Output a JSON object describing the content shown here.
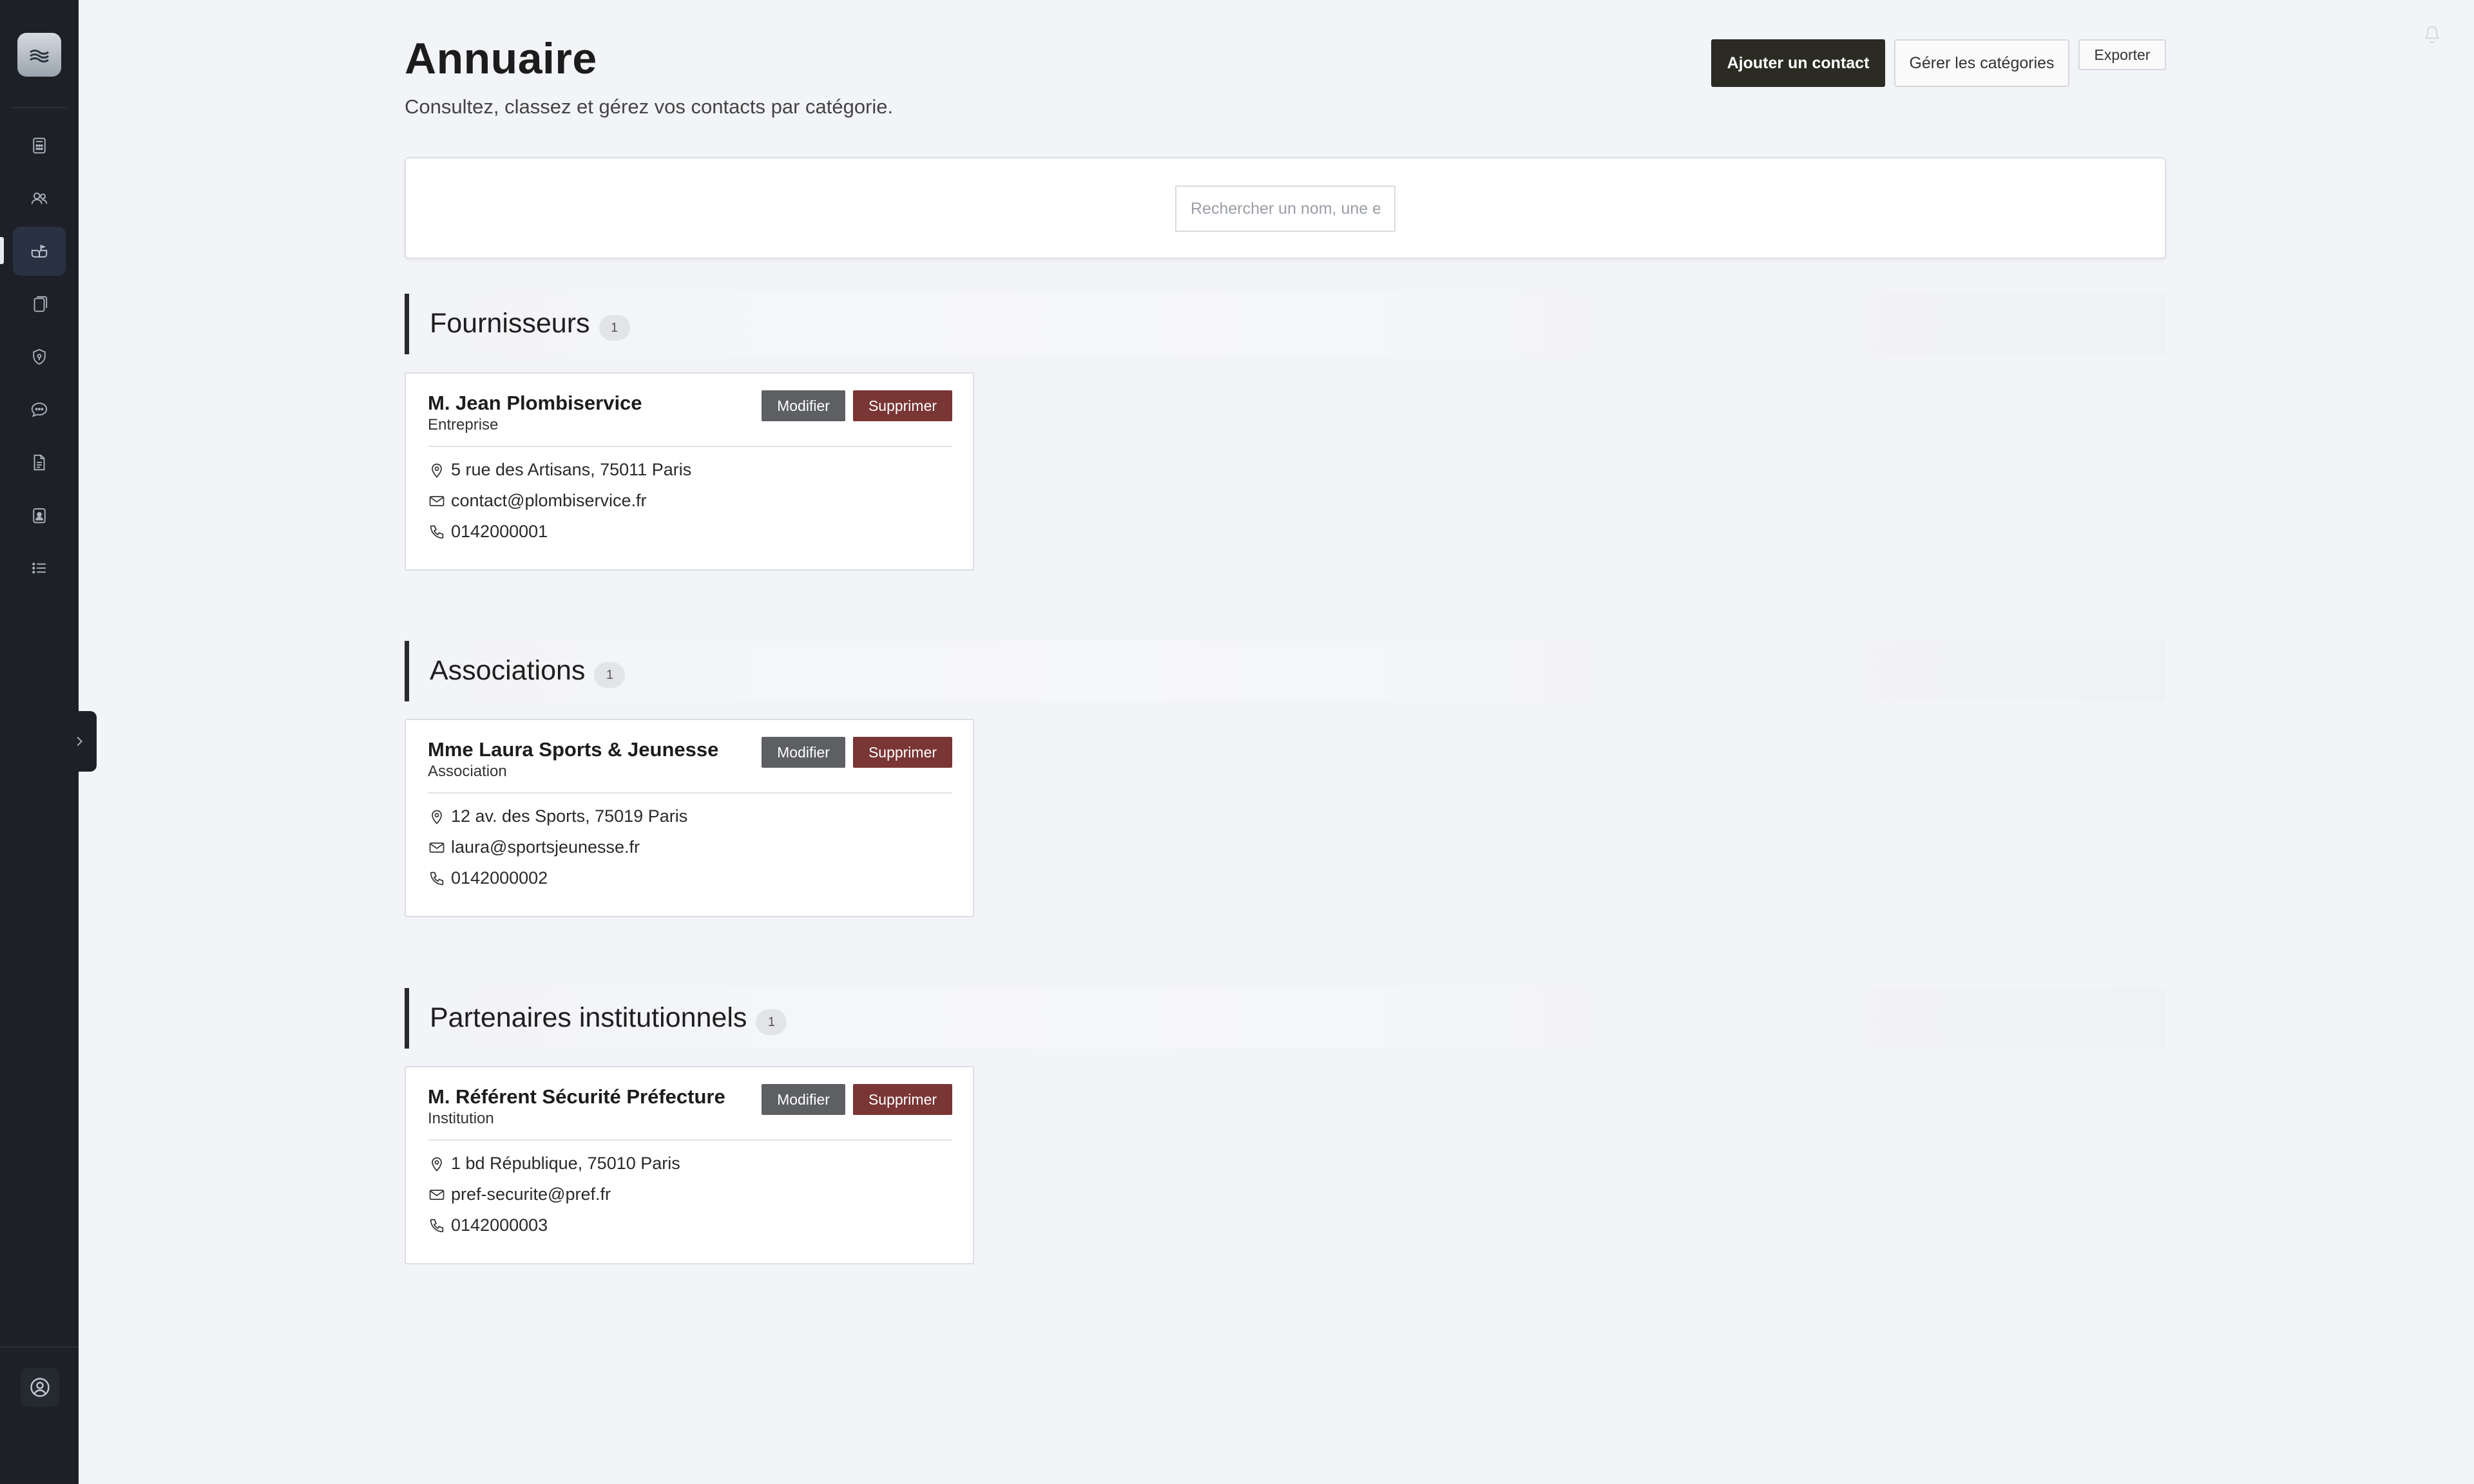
{
  "sidebar": {
    "logo_icon": "waves-logo-icon",
    "items": [
      {
        "icon": "calculator-icon"
      },
      {
        "icon": "users-icon"
      },
      {
        "icon": "contact-book-icon",
        "active": true
      },
      {
        "icon": "copy-icon"
      },
      {
        "icon": "shield-icon"
      },
      {
        "icon": "chat-icon"
      },
      {
        "icon": "document-icon"
      },
      {
        "icon": "id-badge-icon"
      },
      {
        "icon": "list-icon"
      }
    ],
    "user_icon": "user-circle-icon"
  },
  "header": {
    "title": "Annuaire",
    "subtitle": "Consultez, classez et gérez vos contacts par catégorie.",
    "add_contact_label": "Ajouter un contact",
    "manage_categories_label": "Gérer les catégories",
    "export_label": "Exporter"
  },
  "search": {
    "placeholder": "Rechercher un nom, une e",
    "value": ""
  },
  "categories": [
    {
      "name": "Fournisseurs",
      "count": "1",
      "contacts": [
        {
          "name": "M. Jean Plombiservice",
          "type": "Entreprise",
          "address": "5 rue des Artisans, 75011 Paris",
          "email": "contact@plombiservice.fr",
          "phone": "0142000001"
        }
      ]
    },
    {
      "name": "Associations",
      "count": "1",
      "contacts": [
        {
          "name": "Mme Laura Sports & Jeunesse",
          "type": "Association",
          "address": "12 av. des Sports, 75019 Paris",
          "email": "laura@sportsjeunesse.fr",
          "phone": "0142000002"
        }
      ]
    },
    {
      "name": "Partenaires institutionnels",
      "count": "1",
      "contacts": [
        {
          "name": "M. Référent Sécurité Préfecture",
          "type": "Institution",
          "address": "1 bd République, 75010 Paris",
          "email": "pref-securite@pref.fr",
          "phone": "0142000003"
        }
      ]
    }
  ],
  "card_actions": {
    "edit_label": "Modifier",
    "delete_label": "Supprimer"
  },
  "colors": {
    "sidebar_bg": "#1d2127",
    "primary_button": "#2b2b24",
    "edit_button": "#5d5f63",
    "delete_button": "#7a3535",
    "page_bg": "#f3f4f7"
  }
}
